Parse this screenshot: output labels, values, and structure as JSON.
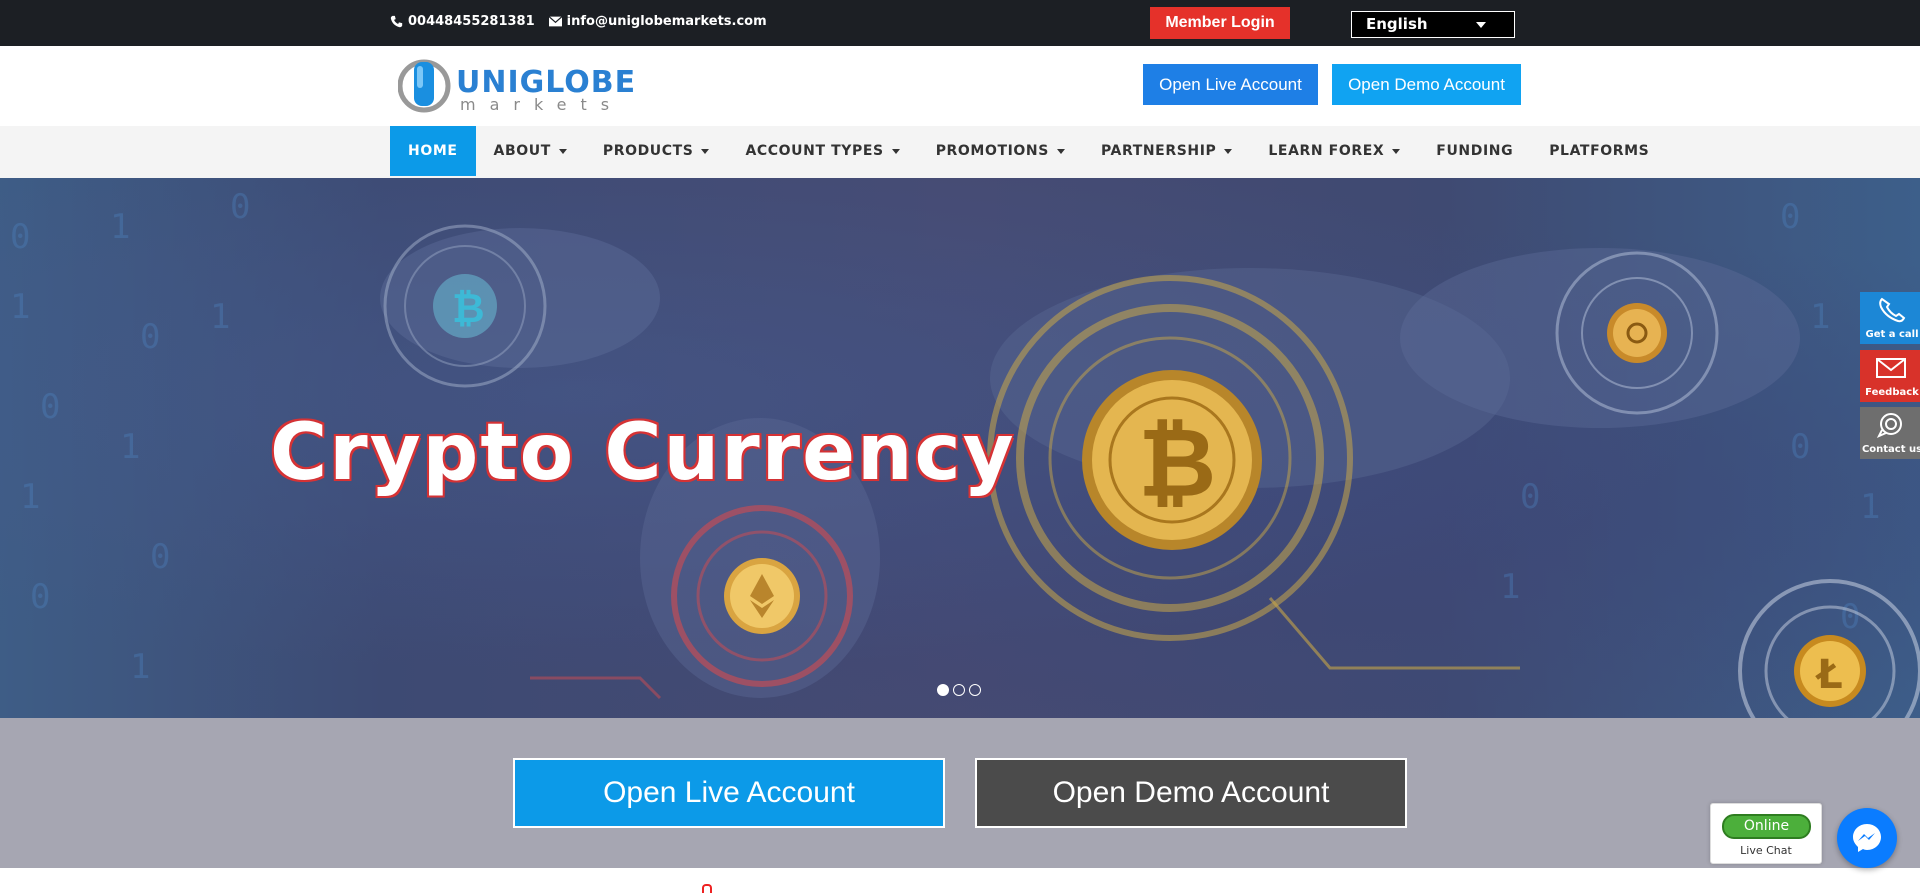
{
  "topbar": {
    "phone": "00448455281381",
    "email": "info@uniglobemarkets.com",
    "member_login": "Member Login",
    "language": "English"
  },
  "header": {
    "logo_text": "UNIGLOBE",
    "logo_subtext": "markets",
    "open_live": "Open Live Account",
    "open_demo": "Open Demo Account"
  },
  "nav": {
    "items": [
      {
        "label": "HOME"
      },
      {
        "label": "ABOUT"
      },
      {
        "label": "PRODUCTS"
      },
      {
        "label": "ACCOUNT TYPES"
      },
      {
        "label": "PROMOTIONS"
      },
      {
        "label": "PARTNERSHIP"
      },
      {
        "label": "LEARN FOREX"
      },
      {
        "label": "FUNDING"
      },
      {
        "label": "PLATFORMS"
      }
    ]
  },
  "hero": {
    "title": "Crypto Currency",
    "slide_count": 3,
    "active_slide": 1
  },
  "cta": {
    "open_live": "Open Live Account",
    "open_demo": "Open Demo Account"
  },
  "side_widgets": {
    "call": "Get a call",
    "feedback": "Feedback",
    "contact": "Contact us"
  },
  "livechat": {
    "status": "Online",
    "label": "Live Chat"
  },
  "colors": {
    "topbar": "#1c1f24",
    "brand_blue": "#0c9ae8",
    "member_login": "#e5312a"
  }
}
